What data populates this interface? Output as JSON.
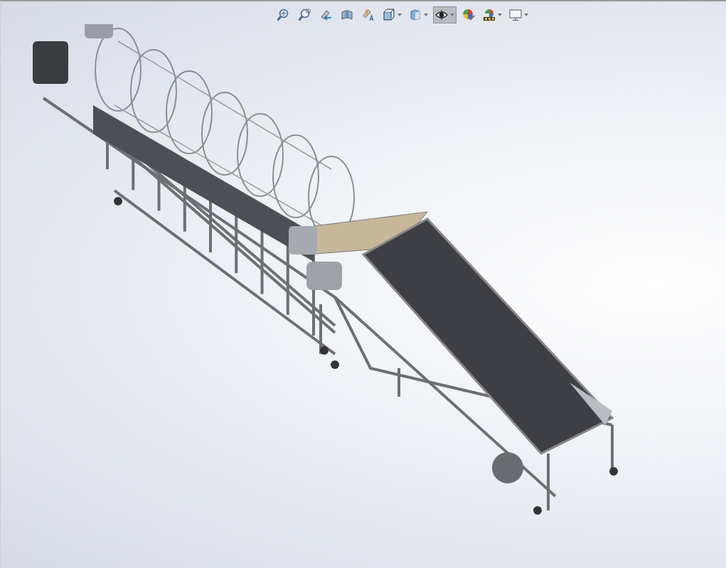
{
  "heads_up_toolbar": {
    "items": [
      {
        "kind": "zoom-fit",
        "has_menu": false,
        "selected": false
      },
      {
        "kind": "zoom-area",
        "has_menu": false,
        "selected": false
      },
      {
        "kind": "previous-view",
        "has_menu": false,
        "selected": false
      },
      {
        "kind": "section-view",
        "has_menu": false,
        "selected": false
      },
      {
        "kind": "dynamic-annotation",
        "has_menu": false,
        "selected": false
      },
      {
        "kind": "view-orientation",
        "has_menu": true,
        "selected": false
      },
      {
        "kind": "display-style",
        "has_menu": true,
        "selected": false
      },
      {
        "kind": "hide-show",
        "has_menu": true,
        "selected": true
      },
      {
        "kind": "edit-appearance",
        "has_menu": false,
        "selected": false
      },
      {
        "kind": "apply-scene",
        "has_menu": true,
        "selected": false
      },
      {
        "kind": "view-settings",
        "has_menu": true,
        "selected": false
      }
    ]
  }
}
